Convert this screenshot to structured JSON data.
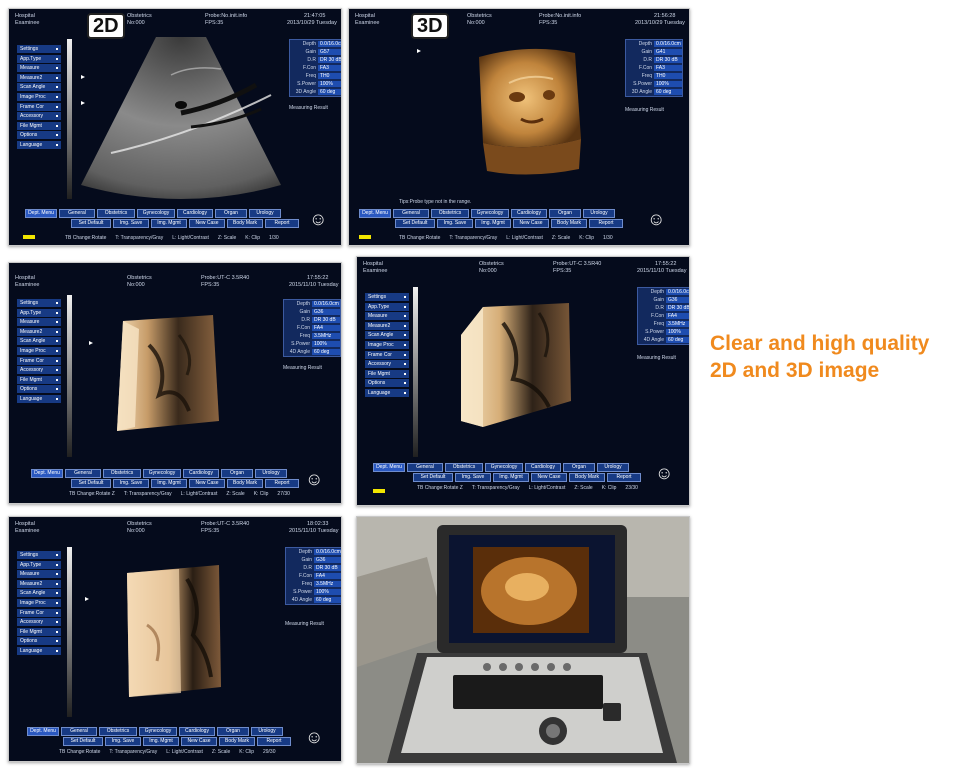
{
  "headline": {
    "line1": "Clear and high quality",
    "line2": "2D and 3D image",
    "color": "#f08a1e"
  },
  "panels": {
    "p1": {
      "mode_label": "2D",
      "hospital": "Hospital",
      "examinee": "Examinee",
      "exam": "Obstetrics",
      "no": "No:000",
      "probe": "Probe:No.init.info",
      "fps": "FPS:35",
      "time": "21:47:05",
      "date": "2013/10/29 Tuesday",
      "params": [
        {
          "k": "Depth",
          "v": "0.0/16.0cm"
        },
        {
          "k": "Gain",
          "v": "G57"
        },
        {
          "k": "D.R",
          "v": "DR 30 dB"
        },
        {
          "k": "F.Con",
          "v": "FA3"
        },
        {
          "k": "Freq",
          "v": "TH0"
        },
        {
          "k": "S.Power",
          "v": "100%"
        },
        {
          "k": "3D Angle",
          "v": "60 deg"
        }
      ],
      "bottom": [
        "TB Change:Rotate",
        "T: Transparency/Gray",
        "L: Light/Contrast",
        "Z: Scale",
        "K: Clip",
        "1/30"
      ]
    },
    "p2": {
      "mode_label": "3D",
      "hospital": "Hospital",
      "examinee": "Examinee",
      "exam": "Obstetrics",
      "no": "No:000",
      "probe": "Probe:No.init.info",
      "fps": "FPS:35",
      "time": "21:56:28",
      "date": "2013/10/29 Tuesday",
      "params": [
        {
          "k": "Depth",
          "v": "0.0/16.0cm"
        },
        {
          "k": "Gain",
          "v": "G41"
        },
        {
          "k": "D.R",
          "v": "DR 30 dB"
        },
        {
          "k": "F.Con",
          "v": "FA3"
        },
        {
          "k": "Freq",
          "v": "TH0"
        },
        {
          "k": "S.Power",
          "v": "100%"
        },
        {
          "k": "3D Angle",
          "v": "60 deg"
        }
      ],
      "tip": "Tips:Probe type not in the range.",
      "bottom": [
        "TB Change:Rotate",
        "T: Transparency/Gray",
        "L: Light/Contrast",
        "Z: Scale",
        "K: Clip",
        "1/30"
      ]
    },
    "p3": {
      "hospital": "Hospital",
      "examinee": "Examinee",
      "exam": "Obstetrics",
      "no": "No:000",
      "probe": "Probe:UT-C 3.5R40",
      "fps": "FPS:35",
      "time": "17:55:22",
      "date": "2015/11/10 Tuesday",
      "params": [
        {
          "k": "Depth",
          "v": "0.0/16.0cm"
        },
        {
          "k": "Gain",
          "v": "G36"
        },
        {
          "k": "D.R",
          "v": "DR 30 dB"
        },
        {
          "k": "F.Con",
          "v": "FA4"
        },
        {
          "k": "Freq",
          "v": "3.5MHz"
        },
        {
          "k": "S.Power",
          "v": "100%"
        },
        {
          "k": "4D Angle",
          "v": "60 deg"
        }
      ],
      "bottom": [
        "TB Change:Rotate Z",
        "T: Transparency/Gray",
        "L: Light/Contrast",
        "Z: Scale",
        "K: Clip",
        "27/30"
      ]
    },
    "p4": {
      "hospital": "Hospital",
      "examinee": "Examinee",
      "exam": "Obstetrics",
      "no": "No:000",
      "probe": "Probe:UT-C 3.5R40",
      "fps": "FPS:35",
      "time": "17:55:22",
      "date": "2015/11/10 Tuesday",
      "params": [
        {
          "k": "Depth",
          "v": "0.0/16.0cm"
        },
        {
          "k": "Gain",
          "v": "G36"
        },
        {
          "k": "D.R",
          "v": "DR 30 dB"
        },
        {
          "k": "F.Con",
          "v": "FA4"
        },
        {
          "k": "Freq",
          "v": "3.5MHz"
        },
        {
          "k": "S.Power",
          "v": "100%"
        },
        {
          "k": "4D Angle",
          "v": "60 deg"
        }
      ],
      "bottom": [
        "TB Change:Rotate Z",
        "T: Transparency/Gray",
        "L: Light/Contrast",
        "Z: Scale",
        "K: Clip",
        "23/30"
      ]
    },
    "p5": {
      "hospital": "Hospital",
      "examinee": "Examinee",
      "exam": "Obstetrics",
      "no": "No:000",
      "probe": "Probe:UT-C 3.5R40",
      "fps": "FPS:35",
      "time": "18:02:33",
      "date": "2015/11/10 Tuesday",
      "params": [
        {
          "k": "Depth",
          "v": "0.0/16.0cm"
        },
        {
          "k": "Gain",
          "v": "G36"
        },
        {
          "k": "D.R",
          "v": "DR 30 dB"
        },
        {
          "k": "F.Con",
          "v": "FA4"
        },
        {
          "k": "Freq",
          "v": "3.5MHz"
        },
        {
          "k": "S.Power",
          "v": "100%"
        },
        {
          "k": "4D Angle",
          "v": "60 deg"
        }
      ],
      "bottom": [
        "TB Change:Rotate",
        "T: Transparency/Gray",
        "L: Light/Contrast",
        "Z: Scale",
        "K: Clip",
        "29/30"
      ]
    }
  },
  "sidebar": [
    "Settings",
    "App.Type",
    "Measure",
    "Measure2",
    "Scan Angle",
    "Image Proc",
    "Frame Cor",
    "Accessory",
    "File Mgmt",
    "Options",
    "Language"
  ],
  "measuring_result": "Measuring Result",
  "menu_row1": [
    "Dept. Menu",
    "General",
    "Obstetrics",
    "Gynecology",
    "Cardiology",
    "Organ",
    "Urology"
  ],
  "menu_row2": [
    "Set Default",
    "Img. Save",
    "Img. Mgmt",
    "New Case",
    "Body Mark",
    "Report"
  ],
  "icons": [
    "baby-icon",
    "cursor-icon",
    "probe-icon"
  ]
}
